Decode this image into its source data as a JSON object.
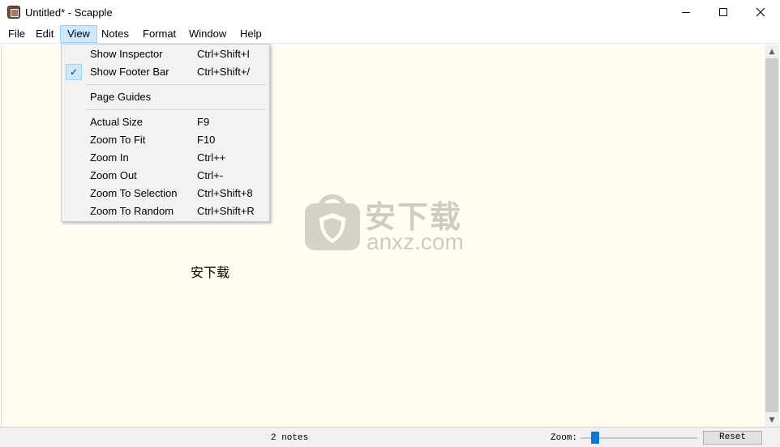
{
  "window": {
    "title": "Untitled* - Scapple",
    "icons": {
      "app": "scapple-app-icon",
      "minimize": "minimize-icon",
      "maximize": "maximize-icon",
      "close": "close-icon"
    }
  },
  "menubar": {
    "items": [
      {
        "label": "File"
      },
      {
        "label": "Edit"
      },
      {
        "label": "View"
      },
      {
        "label": "Notes"
      },
      {
        "label": "Format"
      },
      {
        "label": "Window"
      },
      {
        "label": "Help"
      }
    ],
    "active": "View"
  },
  "view_menu": {
    "items": [
      {
        "label": "Show Inspector",
        "shortcut": "Ctrl+Shift+I"
      },
      {
        "label": "Show Footer Bar",
        "shortcut": "Ctrl+Shift+/",
        "checked": true
      },
      {
        "label": "Page Guides",
        "shortcut": ""
      },
      {
        "label": "Actual Size",
        "shortcut": "F9"
      },
      {
        "label": "Zoom To Fit",
        "shortcut": "F10"
      },
      {
        "label": "Zoom In",
        "shortcut": "Ctrl++"
      },
      {
        "label": "Zoom Out",
        "shortcut": "Ctrl+-"
      },
      {
        "label": "Zoom To Selection",
        "shortcut": "Ctrl+Shift+8"
      },
      {
        "label": "Zoom To Random",
        "shortcut": "Ctrl+Shift+R"
      }
    ]
  },
  "canvas": {
    "note_text": "安下载",
    "background_color": "#fffdf2",
    "watermark": {
      "cn": "安下载",
      "en": "anxz.com"
    }
  },
  "footer": {
    "notes_count": "2 notes",
    "zoom_label": "Zoom:",
    "reset_label": "Reset"
  },
  "colors": {
    "menu_highlight": "#cce8ff",
    "slider_accent": "#0a78d7"
  }
}
